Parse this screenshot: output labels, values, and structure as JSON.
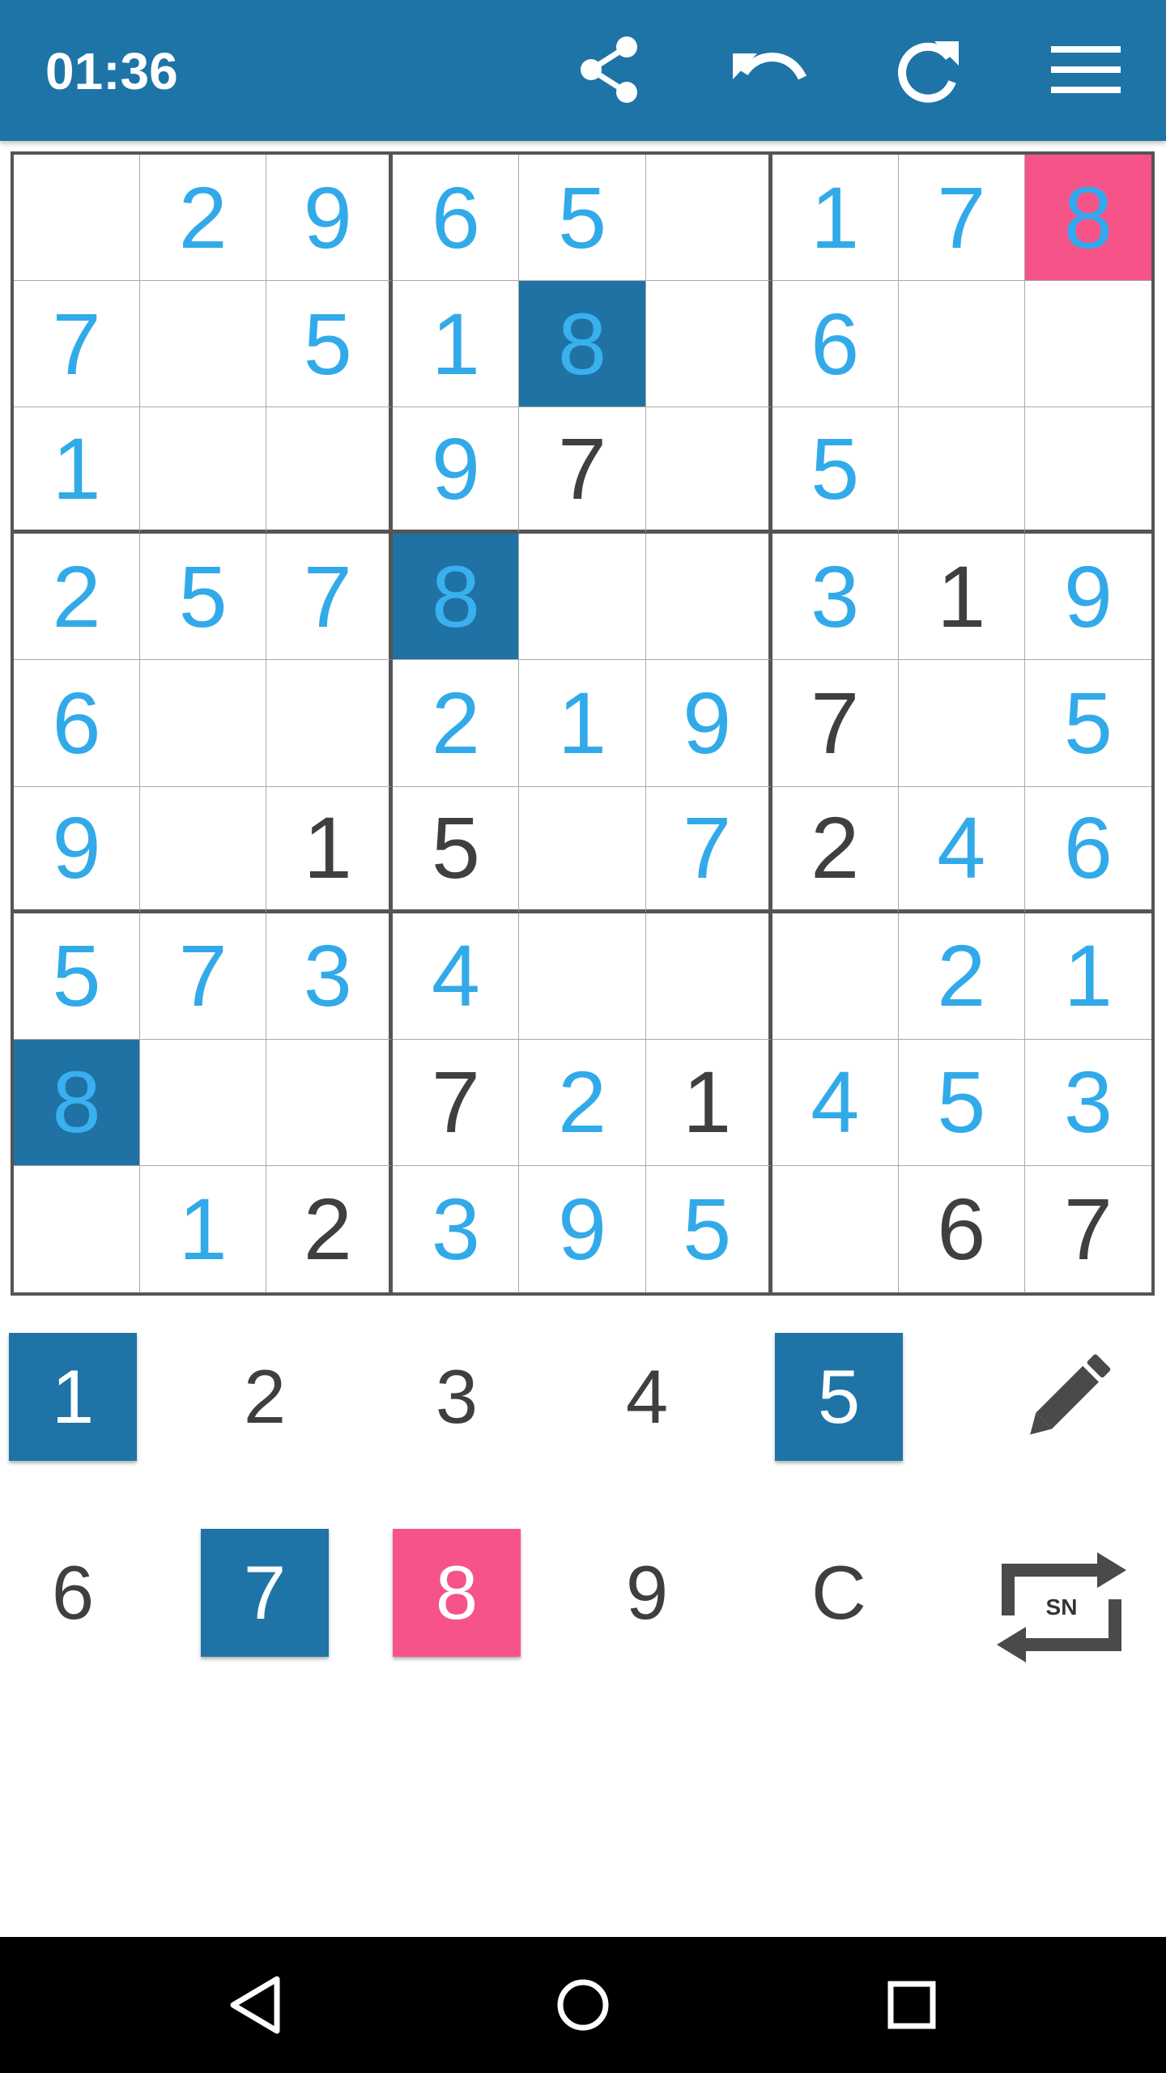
{
  "header": {
    "timer": "01:36",
    "icons": [
      "share-icon",
      "undo-icon",
      "redo-icon",
      "menu-icon"
    ]
  },
  "board": {
    "rows": [
      [
        "",
        "2",
        "9",
        "6",
        "5",
        "",
        "1",
        "7",
        "8"
      ],
      [
        "7",
        "",
        "5",
        "1",
        "8",
        "",
        "6",
        "",
        ""
      ],
      [
        "1",
        "",
        "",
        "9",
        "7",
        "",
        "5",
        "",
        ""
      ],
      [
        "2",
        "5",
        "7",
        "8",
        "",
        "",
        "3",
        "1",
        "9"
      ],
      [
        "6",
        "",
        "",
        "2",
        "1",
        "9",
        "7",
        "",
        "5"
      ],
      [
        "9",
        "",
        "1",
        "5",
        "",
        "7",
        "2",
        "4",
        "6"
      ],
      [
        "5",
        "7",
        "3",
        "4",
        "",
        "",
        "",
        "2",
        "1"
      ],
      [
        "8",
        "",
        "",
        "7",
        "2",
        "1",
        "4",
        "5",
        "3"
      ],
      [
        "",
        "1",
        "2",
        "3",
        "9",
        "5",
        "",
        "6",
        "7"
      ]
    ],
    "given": [
      [
        2,
        4
      ],
      [
        3,
        7
      ],
      [
        5,
        2
      ],
      [
        5,
        3
      ],
      [
        5,
        6
      ],
      [
        4,
        6
      ],
      [
        7,
        3
      ],
      [
        7,
        5
      ],
      [
        8,
        2
      ],
      [
        8,
        7
      ],
      [
        8,
        8
      ]
    ],
    "selected_cells": [
      [
        1,
        4
      ],
      [
        3,
        3
      ],
      [
        7,
        0
      ]
    ],
    "highlight_cells": [
      [
        0,
        8
      ]
    ],
    "colors": {
      "entered_digit": "#32aae9",
      "given_digit": "#3f3f3f",
      "selected_bg": "#1f72a3",
      "highlight_bg": "#f65488",
      "header_bg": "#1e74a6"
    }
  },
  "keypad": {
    "row1": [
      {
        "label": "1",
        "state": "on"
      },
      {
        "label": "2",
        "state": "off"
      },
      {
        "label": "3",
        "state": "off"
      },
      {
        "label": "4",
        "state": "off"
      },
      {
        "label": "5",
        "state": "on"
      }
    ],
    "row2": [
      {
        "label": "6",
        "state": "off"
      },
      {
        "label": "7",
        "state": "on"
      },
      {
        "label": "8",
        "state": "pink"
      },
      {
        "label": "9",
        "state": "off"
      },
      {
        "label": "C",
        "state": "off"
      }
    ],
    "pencil_icon": "pencil-icon",
    "swap_icon": "swap-sn-icon",
    "swap_label": "SN"
  },
  "navbar": {
    "icons": [
      "back-icon",
      "home-icon",
      "recents-icon"
    ]
  }
}
